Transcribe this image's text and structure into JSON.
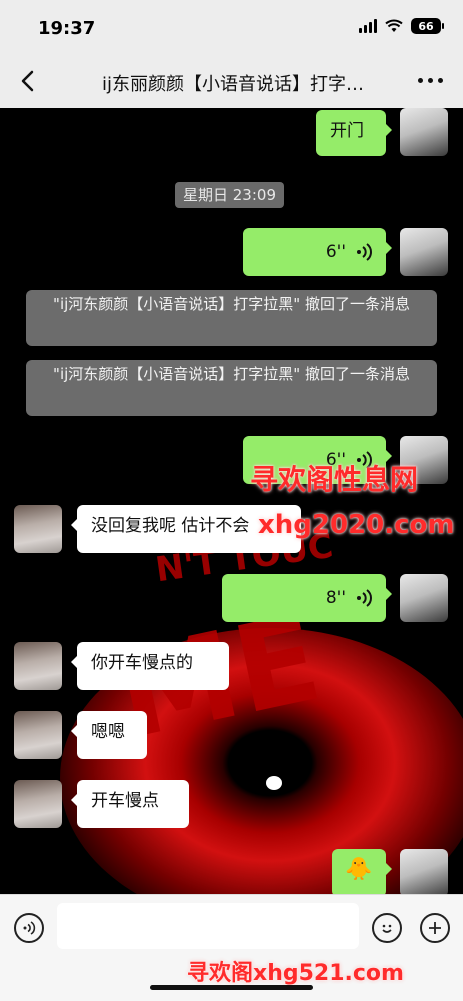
{
  "status_bar": {
    "time": "19:37",
    "battery": "66"
  },
  "header": {
    "title": "ij东丽颜颜【小语音说话】打字…"
  },
  "messages": {
    "m1_text": "开门",
    "timestamp": "星期日 23:09",
    "m2_duration": "6''",
    "recall_1": "\"ij河东颜颜【小语音说话】打字拉黑\" 撤回了一条消息",
    "recall_2": "\"ij河东颜颜【小语音说话】打字拉黑\" 撤回了一条消息",
    "m3_duration": "6''",
    "m4_text": "没回复我呢 估计不会",
    "m5_duration": "8''",
    "m6_text": "你开车慢点的",
    "m7_text": "嗯嗯",
    "m8_text": "开车慢点",
    "m9_emoji": "🐥"
  },
  "background": {
    "text_dont_touch": "N'T TOUC",
    "text_me": "ME"
  },
  "watermarks": {
    "w1": "寻欢阁性息网",
    "w2": "xhg2020.com",
    "w3": "寻欢阁xhg521.com"
  },
  "colors": {
    "self_bubble": "#95ec69",
    "other_bubble": "#ffffff",
    "watermark": "#ff2b2b"
  },
  "icons": [
    "back-icon",
    "more-icon",
    "voice-wave-icon",
    "voice-mode-icon",
    "emoji-icon",
    "plus-icon"
  ]
}
